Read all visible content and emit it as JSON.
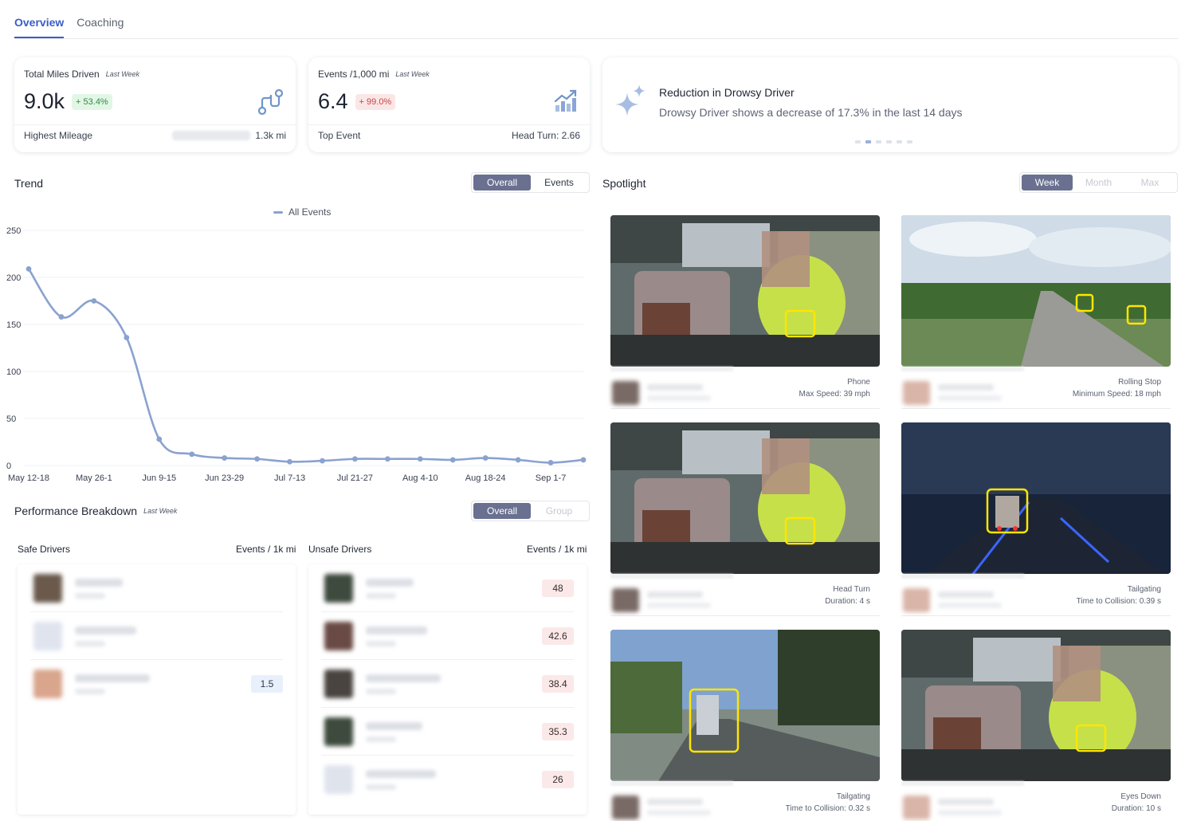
{
  "tabs": [
    {
      "label": "Overview",
      "active": true
    },
    {
      "label": "Coaching",
      "active": false
    }
  ],
  "stats": {
    "miles": {
      "title": "Total Miles Driven",
      "period": "Last Week",
      "value": "9.0k",
      "change": "+ 53.4%",
      "footer_label": "Highest Mileage",
      "footer_value": "1.3k mi",
      "icon": "route-icon"
    },
    "events": {
      "title": "Events /1,000 mi",
      "period": "Last Week",
      "value": "6.4",
      "change": "+ 99.0%",
      "footer_label": "Top Event",
      "footer_value": "Head Turn: 2.66",
      "icon": "growth-chart-icon"
    }
  },
  "insight": {
    "icon": "sparkle-icon",
    "title": "Reduction in Drowsy Driver",
    "text": "Drowsy Driver shows a decrease of 17.3% in the last 14 days",
    "active_dot": 1,
    "dot_count": 6
  },
  "trend": {
    "title": "Trend",
    "toggle": [
      "Overall",
      "Events"
    ],
    "toggle_selected": "Overall"
  },
  "chart_data": {
    "type": "line",
    "title": "",
    "xlabel": "",
    "ylabel": "",
    "ylim": [
      0,
      250
    ],
    "yticks": [
      0,
      50,
      100,
      150,
      200,
      250
    ],
    "x_tick_labels": [
      "May 12-18",
      "May 26-1",
      "Jun 9-15",
      "Jun 23-29",
      "Jul 7-13",
      "Jul 21-27",
      "Aug 4-10",
      "Aug 18-24",
      "Sep 1-7"
    ],
    "grid": true,
    "legend": "top-center",
    "series": [
      {
        "name": "All Events",
        "color": "#8aa2cf",
        "values": [
          209,
          158,
          175,
          136,
          28,
          12,
          8,
          7,
          4,
          5,
          7,
          7,
          7,
          6,
          8,
          6,
          3,
          6
        ]
      }
    ]
  },
  "performance": {
    "title": "Performance Breakdown",
    "period": "Last Week",
    "toggle": [
      "Overall",
      "Group"
    ],
    "toggle_selected": "Overall",
    "safe": {
      "label": "Safe Drivers",
      "metric": "Events / 1k mi",
      "rows": [
        {
          "score": "",
          "avatar": "#6b5a4c"
        },
        {
          "score": "",
          "avatar": "#dfe4ee"
        },
        {
          "score": "1.5",
          "avatar": "#d9a58c"
        }
      ]
    },
    "unsafe": {
      "label": "Unsafe Drivers",
      "metric": "Events / 1k mi",
      "rows": [
        {
          "score": "48",
          "avatar": "#3f4a3e"
        },
        {
          "score": "42.6",
          "avatar": "#6a4a44"
        },
        {
          "score": "38.4",
          "avatar": "#4a4440"
        },
        {
          "score": "35.3",
          "avatar": "#3d4a3d"
        },
        {
          "score": "26",
          "avatar": "#dfe3ec"
        }
      ]
    }
  },
  "spotlight": {
    "title": "Spotlight",
    "toggle": [
      "Week",
      "Month",
      "Max"
    ],
    "toggle_selected": "Week",
    "items": [
      {
        "event": "Phone",
        "detail": "Max Speed: 39 mph",
        "scene": "cab-day"
      },
      {
        "event": "Rolling Stop",
        "detail": "Minimum Speed: 18 mph",
        "scene": "road-day"
      },
      {
        "event": "Head Turn",
        "detail": "Duration: 4 s",
        "scene": "cab-day"
      },
      {
        "event": "Tailgating",
        "detail": "Time to Collision: 0.39 s",
        "scene": "road-night"
      },
      {
        "event": "Tailgating",
        "detail": "Time to Collision: 0.32 s",
        "scene": "road-forest"
      },
      {
        "event": "Eyes Down",
        "detail": "Duration: 10 s",
        "scene": "cab-day"
      }
    ]
  }
}
